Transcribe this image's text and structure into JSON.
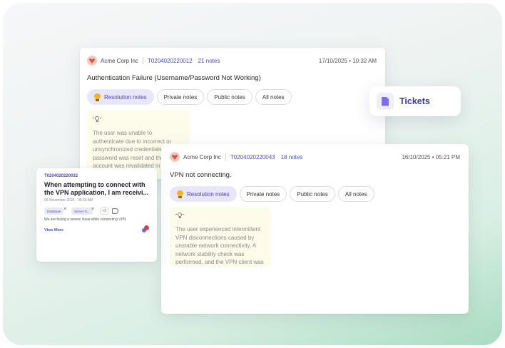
{
  "tickets_badge": {
    "label": "Tickets",
    "icon": "document-icon",
    "accent": "#3b3e9a"
  },
  "card_back": {
    "company": "Acme Corp Inc",
    "ticket_id": "T0204020220012",
    "notes_count": "21 notes",
    "date": "17/10/2025 • 10:32 AM",
    "title": "Authentication Failure (Username/Password Not Working)",
    "tabs": [
      "Resolution notes",
      "Private notes",
      "Public notes",
      "All notes"
    ],
    "active_tab": "Resolution notes",
    "note": "The user was unable to authenticate due to incorrect or unsynchronized credentials. The password was reset and the account was revalidated in the authentication directory."
  },
  "card_front": {
    "company": "Acme Corp Inc",
    "ticket_id": "T0204020220043",
    "notes_count": "18 notes",
    "date": "16/10/2025 • 05:21 PM",
    "title": "VPN not connecting.",
    "tabs": [
      "Resolution notes",
      "Private notes",
      "Public notes",
      "All notes"
    ],
    "active_tab": "Resolution notes",
    "note": "The user experienced intermittent VPN disconnections caused by unstable network connectivity. A network stability check was performed, and the VPN client was u..."
  },
  "mini_card": {
    "ticket_id": "T0204020220032",
    "title_line1": "When attempting to connect with",
    "title_line2": "the VPN application, I am receivi...",
    "date": "06 November 2025 · 09:39 AM",
    "chips": [
      "Database",
      "Server D..."
    ],
    "more": "+3",
    "description": "We are facing a severe issue while connecting VPN",
    "view_more": "View More"
  },
  "colors": {
    "accent": "#4a4ac4",
    "active_tab_bg": "#e8e6fb",
    "note_bg": "#fdfbea",
    "logo": "#e0513f"
  }
}
